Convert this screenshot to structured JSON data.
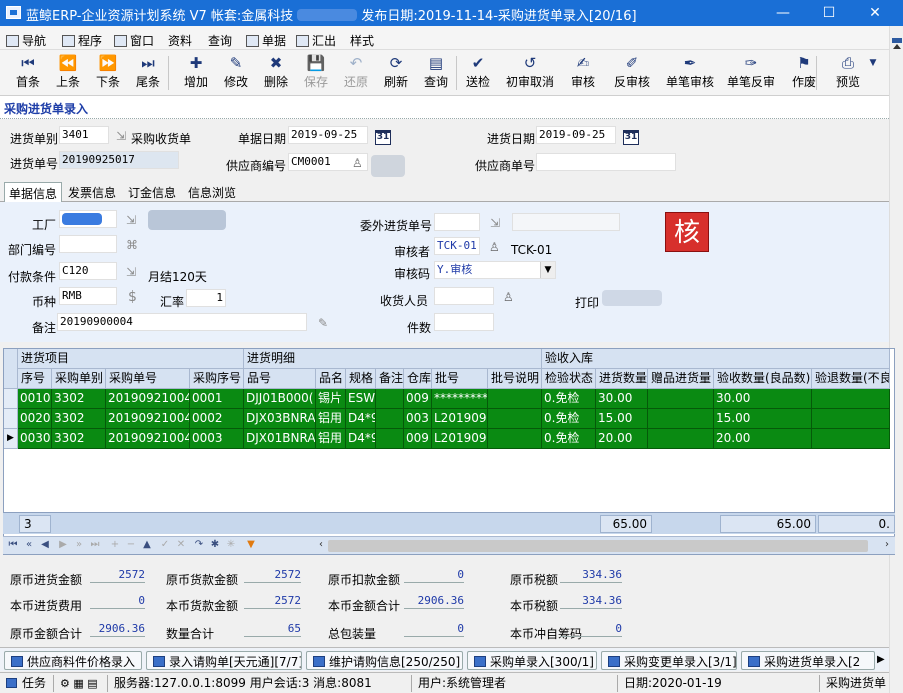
{
  "window": {
    "title_prefix": "蓝鲸ERP-企业资源计划系统 V7 帐套:金属科技",
    "title_suffix": "发布日期:2019-11-14-采购进货单录入[20/16]",
    "minimize": "—",
    "maximize": "☐",
    "close": "✕"
  },
  "menu": [
    "导航",
    "程序",
    "窗口",
    "资料",
    "查询",
    "单据",
    "汇出",
    "样式"
  ],
  "toolbar": [
    {
      "label": "首条",
      "icon": "first-icon",
      "glyph": "⏮",
      "disabled": false
    },
    {
      "label": "上条",
      "icon": "prev-icon",
      "glyph": "⏪",
      "disabled": false
    },
    {
      "label": "下条",
      "icon": "next-icon",
      "glyph": "⏩",
      "disabled": false
    },
    {
      "label": "尾条",
      "icon": "last-icon",
      "glyph": "⏭",
      "disabled": false
    },
    {
      "label": "增加",
      "icon": "add-icon",
      "glyph": "✚",
      "disabled": false
    },
    {
      "label": "修改",
      "icon": "edit-icon",
      "glyph": "✎",
      "disabled": false
    },
    {
      "label": "删除",
      "icon": "delete-icon",
      "glyph": "✖",
      "disabled": false
    },
    {
      "label": "保存",
      "icon": "save-icon",
      "glyph": "💾",
      "disabled": true
    },
    {
      "label": "还原",
      "icon": "undo-icon",
      "glyph": "↶",
      "disabled": true
    },
    {
      "label": "刷新",
      "icon": "refresh-icon",
      "glyph": "⟳",
      "disabled": false
    },
    {
      "label": "查询",
      "icon": "query-icon",
      "glyph": "▤",
      "disabled": false
    },
    {
      "label": "送检",
      "icon": "inspect-icon",
      "glyph": "✔",
      "disabled": false
    },
    {
      "label": "初审取消",
      "icon": "cancel-review-icon",
      "glyph": "↺",
      "disabled": false
    },
    {
      "label": "审核",
      "icon": "approve-icon",
      "glyph": "✍",
      "disabled": false
    },
    {
      "label": "反审核",
      "icon": "unapprove-icon",
      "glyph": "✐",
      "disabled": false
    },
    {
      "label": "单笔审核",
      "icon": "single-approve-icon",
      "glyph": "✒",
      "disabled": false
    },
    {
      "label": "单笔反审",
      "icon": "single-unapprove-icon",
      "glyph": "✑",
      "disabled": false
    },
    {
      "label": "作废",
      "icon": "void-icon",
      "glyph": "⚑",
      "disabled": false
    },
    {
      "label": "预览",
      "icon": "preview-icon",
      "glyph": "⎙",
      "disabled": false
    }
  ],
  "form_title": "采购进货单录入",
  "header": {
    "type_label": "进货单别",
    "type_value": "3401",
    "type_name": "采购收货单",
    "doc_date_label": "单据日期",
    "doc_date": "2019-09-25",
    "recv_date_label": "进货日期",
    "recv_date": "2019-09-25",
    "no_label": "进货单号",
    "no_value": "20190925017",
    "supplier_label": "供应商编号",
    "supplier_value": "CM0001",
    "supplier_no_label": "供应商单号",
    "supplier_no_value": "",
    "cal_text": "31"
  },
  "tabs": [
    "单据信息",
    "发票信息",
    "订金信息",
    "信息浏览"
  ],
  "info": {
    "factory_label": "工厂",
    "dept_label": "部门编号",
    "pay_label": "付款条件",
    "pay_value": "C120",
    "pay_desc": "月结120天",
    "currency_label": "币种",
    "currency_value": "RMB",
    "rate_label": "汇率",
    "rate_value": "1",
    "remark_label": "备注",
    "remark_value": "20190900004",
    "outsource_label": "委外进货单号",
    "reviewer_label": "审核者",
    "reviewer_value": "TCK-01",
    "reviewer_name": "TCK-01",
    "review_code_label": "审核码",
    "review_code_value": "Y.审核",
    "receiver_label": "收货人员",
    "qty_label": "件数",
    "print_label": "打印",
    "badge": "核"
  },
  "grid": {
    "groups": [
      "进货项目",
      "进货明细",
      "验收入库"
    ],
    "columns": [
      "序号",
      "采购单别",
      "采购单号",
      "采购序号",
      "品号",
      "品名",
      "规格",
      "备注",
      "仓库",
      "批号",
      "批号说明",
      "检验状态",
      "进货数量",
      "赠品进货量",
      "验收数量(良品数)",
      "验退数量(不良"
    ],
    "rows": [
      [
        "0010",
        "3302",
        "20190921004",
        "0001",
        "DJJ01B000(",
        "锡片",
        "ESW",
        "",
        "009",
        "**********",
        "",
        "0.免检",
        "30.00",
        "",
        "30.00",
        ""
      ],
      [
        "0020",
        "3302",
        "20190921004",
        "0002",
        "DJX03BNRA",
        "铝用",
        "D4*9",
        "",
        "003",
        "L201909",
        "",
        "0.免检",
        "15.00",
        "",
        "15.00",
        ""
      ],
      [
        "0030",
        "3302",
        "20190921004",
        "0003",
        "DJX01BNRA",
        "铝用",
        "D4*9",
        "",
        "009",
        "L201909",
        "",
        "0.免检",
        "20.00",
        "",
        "20.00",
        ""
      ]
    ],
    "row_count": "3",
    "total_qty": "65.00",
    "total_accept": "65.00",
    "total_tail": "0."
  },
  "summary": [
    {
      "label": "原币进货金额",
      "value": "2572"
    },
    {
      "label": "原币货款金额",
      "value": "2572"
    },
    {
      "label": "原币扣款金额",
      "value": "0"
    },
    {
      "label": "原币税额",
      "value": "334.36"
    },
    {
      "label": "本币进货费用",
      "value": "0"
    },
    {
      "label": "本币货款金额",
      "value": "2572"
    },
    {
      "label": "本币金额合计",
      "value": "2906.36"
    },
    {
      "label": "本币税额",
      "value": "334.36"
    },
    {
      "label": "原币金额合计",
      "value": "2906.36"
    },
    {
      "label": "数量合计",
      "value": "65"
    },
    {
      "label": "总包装量",
      "value": "0"
    },
    {
      "label": "本币冲自筹码",
      "value": "0"
    }
  ],
  "tasks": [
    "供应商料件价格录入",
    "录入请购单[天元通][7/7]",
    "维护请购信息[250/250]",
    "采购单录入[300/1]",
    "采购变更单录入[3/1]",
    "采购进货单录入[2"
  ],
  "status": {
    "task_label": "任务",
    "server": "服务器:127.0.0.1:8099 用户会话:3 消息:8081",
    "user": "用户:系统管理者",
    "date": "日期:2020-01-19",
    "module": "采购进货单"
  }
}
